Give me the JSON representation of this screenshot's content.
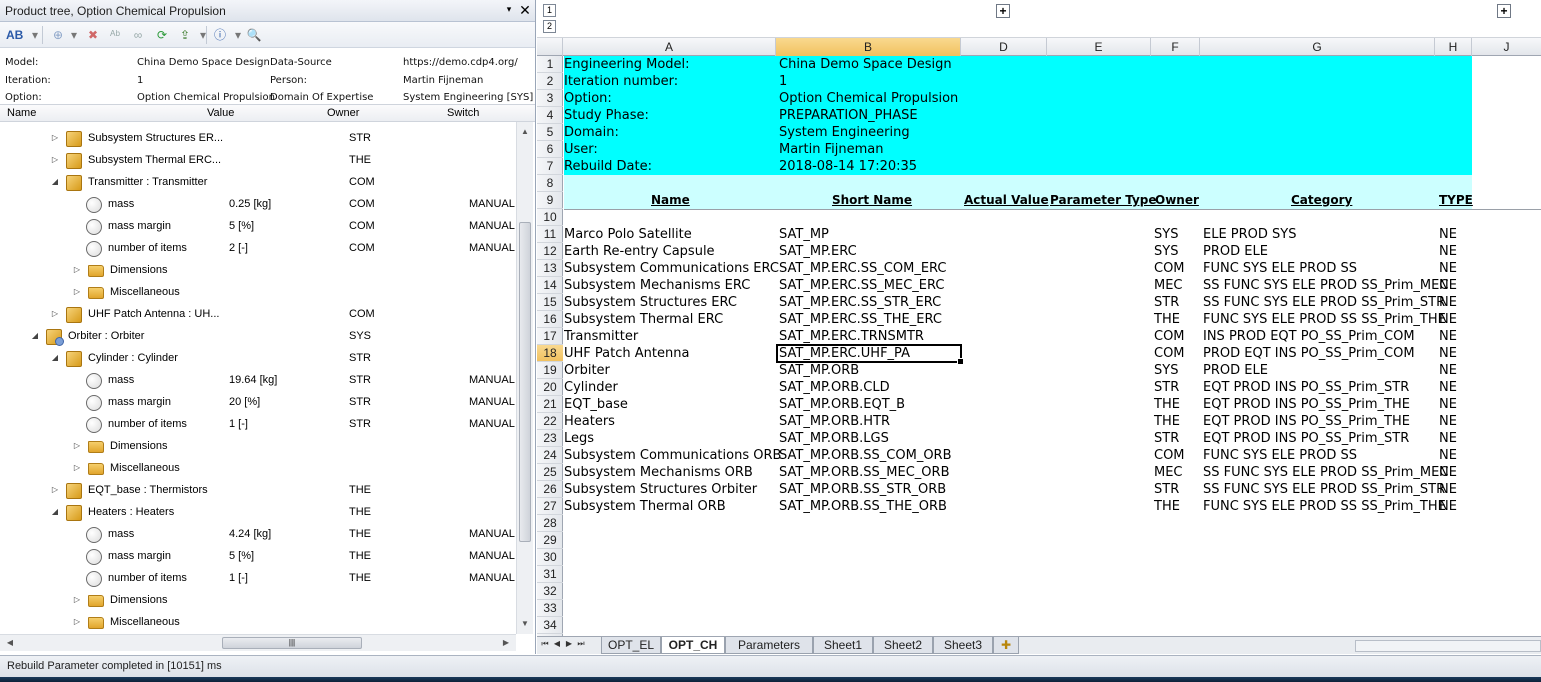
{
  "pane": {
    "title": "Product tree, Option Chemical Propulsion",
    "pin": "▾",
    "close": "✕"
  },
  "toolbar": {
    "icons": [
      "ab-icon",
      "add-icon",
      "delete-icon",
      "rename-icon",
      "spell-icon",
      "refresh-icon",
      "export-icon",
      "info-icon",
      "search-icon"
    ]
  },
  "info": {
    "model_label": "Model:",
    "model_value": "China Demo Space Design",
    "datasource_label": "Data-Source",
    "datasource_value": "https://demo.cdp4.org/",
    "iteration_label": "Iteration:",
    "iteration_value": "1",
    "person_label": "Person:",
    "person_value": "Martin Fijneman",
    "option_label": "Option:",
    "option_value": "Option Chemical Propulsion",
    "domain_label": "Domain Of Expertise",
    "domain_value": "System Engineering [SYS]"
  },
  "tree_headers": {
    "name": "Name",
    "value": "Value",
    "owner": "Owner",
    "switch": "Switch"
  },
  "tree": [
    {
      "label": "Subsystem Structures ER...",
      "value": "",
      "owner": "STR",
      "switch": ""
    },
    {
      "label": "Subsystem Thermal ERC...",
      "value": "",
      "owner": "THE",
      "switch": ""
    },
    {
      "label": "Transmitter : Transmitter",
      "value": "",
      "owner": "COM",
      "switch": ""
    },
    {
      "label": "mass",
      "value": "0.25 [kg]",
      "owner": "COM",
      "switch": "MANUAL"
    },
    {
      "label": "mass margin",
      "value": "5 [%]",
      "owner": "COM",
      "switch": "MANUAL"
    },
    {
      "label": "number of items",
      "value": "2 [-]",
      "owner": "COM",
      "switch": "MANUAL"
    },
    {
      "label": "Dimensions",
      "value": "",
      "owner": "",
      "switch": ""
    },
    {
      "label": "Miscellaneous",
      "value": "",
      "owner": "",
      "switch": ""
    },
    {
      "label": "UHF Patch Antenna : UH...",
      "value": "",
      "owner": "COM",
      "switch": ""
    },
    {
      "label": "Orbiter : Orbiter",
      "value": "",
      "owner": "SYS",
      "switch": ""
    },
    {
      "label": "Cylinder : Cylinder",
      "value": "",
      "owner": "STR",
      "switch": ""
    },
    {
      "label": "mass",
      "value": "19.64 [kg]",
      "owner": "STR",
      "switch": "MANUAL"
    },
    {
      "label": "mass margin",
      "value": "20 [%]",
      "owner": "STR",
      "switch": "MANUAL"
    },
    {
      "label": "number of items",
      "value": "1 [-]",
      "owner": "STR",
      "switch": "MANUAL"
    },
    {
      "label": "Dimensions",
      "value": "",
      "owner": "",
      "switch": ""
    },
    {
      "label": "Miscellaneous",
      "value": "",
      "owner": "",
      "switch": ""
    },
    {
      "label": "EQT_base : Thermistors",
      "value": "",
      "owner": "THE",
      "switch": ""
    },
    {
      "label": "Heaters : Heaters",
      "value": "",
      "owner": "THE",
      "switch": ""
    },
    {
      "label": "mass",
      "value": "4.24 [kg]",
      "owner": "THE",
      "switch": "MANUAL"
    },
    {
      "label": "mass margin",
      "value": "5 [%]",
      "owner": "THE",
      "switch": "MANUAL"
    },
    {
      "label": "number of items",
      "value": "1 [-]",
      "owner": "THE",
      "switch": "MANUAL"
    },
    {
      "label": "Dimensions",
      "value": "",
      "owner": "",
      "switch": ""
    },
    {
      "label": "Miscellaneous",
      "value": "",
      "owner": "",
      "switch": ""
    }
  ],
  "sheet": {
    "outline_levels": [
      "1",
      "2"
    ],
    "columns": [
      "A",
      "B",
      "D",
      "E",
      "F",
      "G",
      "H",
      "J"
    ],
    "selected_column": "B",
    "selected_row": "18",
    "meta": [
      {
        "label": "Engineering Model:",
        "value": "China Demo Space Design"
      },
      {
        "label": "Iteration number:",
        "value": "1"
      },
      {
        "label": "Option:",
        "value": "Option Chemical Propulsion"
      },
      {
        "label": "Study Phase:",
        "value": "PREPARATION_PHASE"
      },
      {
        "label": "Domain:",
        "value": "System Engineering"
      },
      {
        "label": "User:",
        "value": "Martin Fijneman"
      },
      {
        "label": "Rebuild Date:",
        "value": "2018-08-14 17:20:35"
      }
    ],
    "headers": {
      "name": "Name",
      "short_name": "Short Name",
      "actual_value": "Actual Value",
      "parameter_type": "Parameter Type",
      "owner": "Owner",
      "category": "Category",
      "type": "TYPE"
    },
    "rows": [
      {
        "name": "Marco Polo Satellite",
        "short": "SAT_MP",
        "owner": "SYS",
        "category": "ELE PROD SYS",
        "type": "NE"
      },
      {
        "name": "Earth Re-entry Capsule",
        "short": "SAT_MP.ERC",
        "owner": "SYS",
        "category": "PROD ELE",
        "type": "NE"
      },
      {
        "name": "Subsystem Communications ERC",
        "short": "SAT_MP.ERC.SS_COM_ERC",
        "owner": "COM",
        "category": "FUNC SYS ELE PROD SS",
        "type": "NE"
      },
      {
        "name": "Subsystem Mechanisms ERC",
        "short": "SAT_MP.ERC.SS_MEC_ERC",
        "owner": "MEC",
        "category": "SS FUNC SYS ELE PROD SS_Prim_MEC",
        "type": "NE"
      },
      {
        "name": "Subsystem Structures ERC",
        "short": "SAT_MP.ERC.SS_STR_ERC",
        "owner": "STR",
        "category": "SS FUNC SYS ELE PROD SS_Prim_STR",
        "type": "NE"
      },
      {
        "name": "Subsystem Thermal ERC",
        "short": "SAT_MP.ERC.SS_THE_ERC",
        "owner": "THE",
        "category": "FUNC SYS ELE PROD SS SS_Prim_THE",
        "type": "NE"
      },
      {
        "name": "Transmitter",
        "short": "SAT_MP.ERC.TRNSMTR",
        "owner": "COM",
        "category": "INS PROD EQT PO_SS_Prim_COM",
        "type": "NE"
      },
      {
        "name": "UHF Patch Antenna",
        "short": "SAT_MP.ERC.UHF_PA",
        "owner": "COM",
        "category": "PROD EQT INS PO_SS_Prim_COM",
        "type": "NE"
      },
      {
        "name": "Orbiter",
        "short": "SAT_MP.ORB",
        "owner": "SYS",
        "category": "PROD ELE",
        "type": "NE"
      },
      {
        "name": "Cylinder",
        "short": "SAT_MP.ORB.CLD",
        "owner": "STR",
        "category": "EQT PROD INS PO_SS_Prim_STR",
        "type": "NE"
      },
      {
        "name": "EQT_base",
        "short": "SAT_MP.ORB.EQT_B",
        "owner": "THE",
        "category": "EQT PROD INS PO_SS_Prim_THE",
        "type": "NE"
      },
      {
        "name": "Heaters",
        "short": "SAT_MP.ORB.HTR",
        "owner": "THE",
        "category": "EQT PROD INS PO_SS_Prim_THE",
        "type": "NE"
      },
      {
        "name": "Legs",
        "short": "SAT_MP.ORB.LGS",
        "owner": "STR",
        "category": "EQT PROD INS PO_SS_Prim_STR",
        "type": "NE"
      },
      {
        "name": "Subsystem Communications ORB",
        "short": "SAT_MP.ORB.SS_COM_ORB",
        "owner": "COM",
        "category": "FUNC SYS ELE PROD SS",
        "type": "NE"
      },
      {
        "name": "Subsystem Mechanisms ORB",
        "short": "SAT_MP.ORB.SS_MEC_ORB",
        "owner": "MEC",
        "category": "SS FUNC SYS ELE PROD SS_Prim_MEC",
        "type": "NE"
      },
      {
        "name": "Subsystem Structures Orbiter",
        "short": "SAT_MP.ORB.SS_STR_ORB",
        "owner": "STR",
        "category": "SS FUNC SYS ELE PROD SS_Prim_STR",
        "type": "NE"
      },
      {
        "name": "Subsystem Thermal ORB",
        "short": "SAT_MP.ORB.SS_THE_ORB",
        "owner": "THE",
        "category": "FUNC SYS ELE PROD SS SS_Prim_THE",
        "type": "NE"
      }
    ],
    "tabs": [
      "OPT_EL",
      "OPT_CH",
      "Parameters",
      "Sheet1",
      "Sheet2",
      "Sheet3"
    ],
    "active_tab": "OPT_CH"
  },
  "status": {
    "message": "Rebuild Parameter completed in [10151] ms"
  },
  "colors": {
    "header_cyan": "#00ffff",
    "header_light_cyan": "#ccffff",
    "selection": "#f1c15f"
  }
}
